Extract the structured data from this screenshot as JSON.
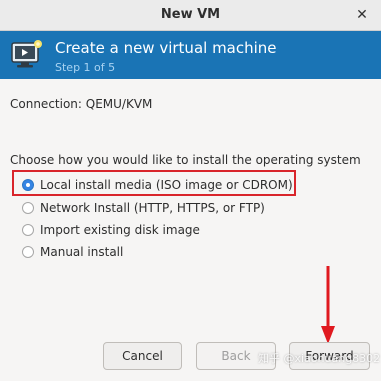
{
  "window": {
    "title": "New VM",
    "close_glyph": "✕"
  },
  "header": {
    "icon": "virtual-machine-icon",
    "title": "Create a new virtual machine",
    "step": "Step 1 of 5"
  },
  "connection": {
    "text": "Connection:  QEMU/KVM"
  },
  "install": {
    "prompt": "Choose how you would like to install the operating system",
    "options": [
      {
        "label": "Local install media (ISO image or CDROM)",
        "selected": true
      },
      {
        "label": "Network Install (HTTP, HTTPS, or FTP)",
        "selected": false
      },
      {
        "label": "Import existing disk image",
        "selected": false
      },
      {
        "label": "Manual install",
        "selected": false
      }
    ]
  },
  "buttons": {
    "cancel": "Cancel",
    "back": "Back",
    "forward": "Forward"
  },
  "annotations": {
    "highlight_color": "#d9252b",
    "arrow_color": "#e0191f"
  },
  "watermark": "知乎 @xiaohuang8302",
  "colors": {
    "header_bg": "#1a74b5",
    "header_step": "#a9d3f2",
    "radio_selected": "#3584e4"
  }
}
